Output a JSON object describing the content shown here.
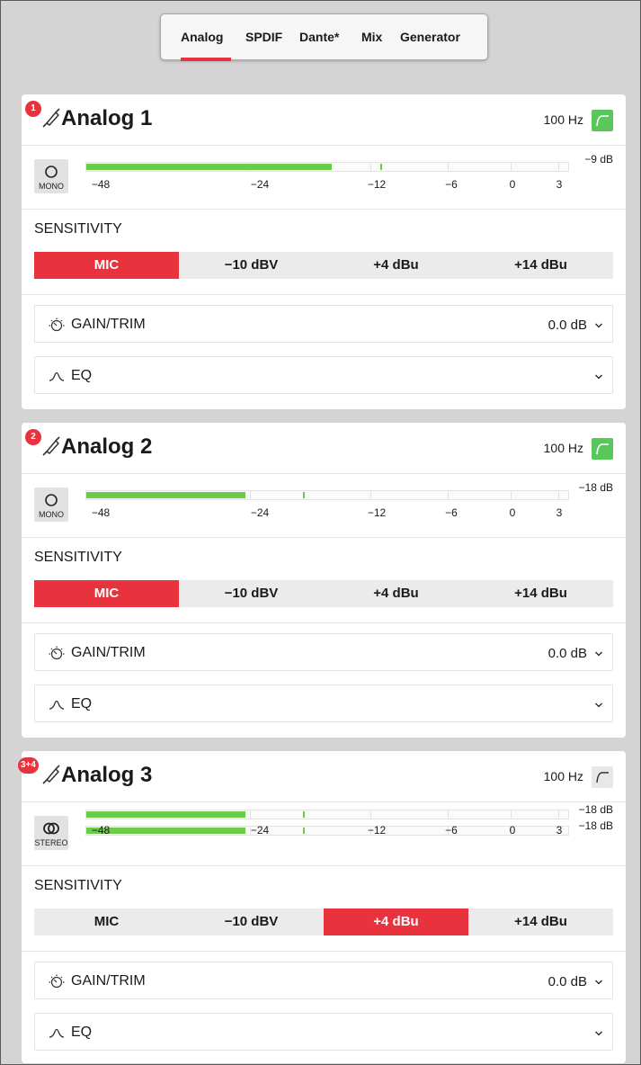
{
  "tabs": [
    "Analog",
    "SPDIF",
    "Dante*",
    "Mix",
    "Generator"
  ],
  "active_tab": "Analog",
  "colors": {
    "accent": "#e8323e",
    "meter": "#6ccc4a",
    "hpf_on": "#5ac75a"
  },
  "scale_labels": [
    "−48",
    "−24",
    "−12",
    "−6",
    "0",
    "3"
  ],
  "channels": [
    {
      "badge": "1",
      "title": "Analog 1",
      "hpf_freq": "100 Hz",
      "hpf_on": true,
      "mode": "MONO",
      "meter_levels": [
        0.51
      ],
      "meter_peaks": [
        0.61
      ],
      "level_readouts": [
        "−9 dB"
      ],
      "sensitivity_label": "SENSITIVITY",
      "sensitivity_options": [
        "MIC",
        "−10 dBV",
        "+4 dBu",
        "+14 dBu"
      ],
      "sensitivity_active": 0,
      "gain_label": "GAIN/TRIM",
      "gain_value": "0.0 dB",
      "eq_label": "EQ"
    },
    {
      "badge": "2",
      "title": "Analog 2",
      "hpf_freq": "100 Hz",
      "hpf_on": true,
      "mode": "MONO",
      "meter_levels": [
        0.33
      ],
      "meter_peaks": [
        0.45
      ],
      "level_readouts": [
        "−18 dB"
      ],
      "sensitivity_label": "SENSITIVITY",
      "sensitivity_options": [
        "MIC",
        "−10 dBV",
        "+4 dBu",
        "+14 dBu"
      ],
      "sensitivity_active": 0,
      "gain_label": "GAIN/TRIM",
      "gain_value": "0.0 dB",
      "eq_label": "EQ"
    },
    {
      "badge": "3+4",
      "title": "Analog 3",
      "hpf_freq": "100 Hz",
      "hpf_on": false,
      "mode": "STEREO",
      "meter_levels": [
        0.33,
        0.33
      ],
      "meter_peaks": [
        0.45,
        0.45
      ],
      "level_readouts": [
        "−18 dB",
        "−18 dB"
      ],
      "sensitivity_label": "SENSITIVITY",
      "sensitivity_options": [
        "MIC",
        "−10 dBV",
        "+4 dBu",
        "+14 dBu"
      ],
      "sensitivity_active": 2,
      "gain_label": "GAIN/TRIM",
      "gain_value": "0.0 dB",
      "eq_label": "EQ"
    }
  ]
}
